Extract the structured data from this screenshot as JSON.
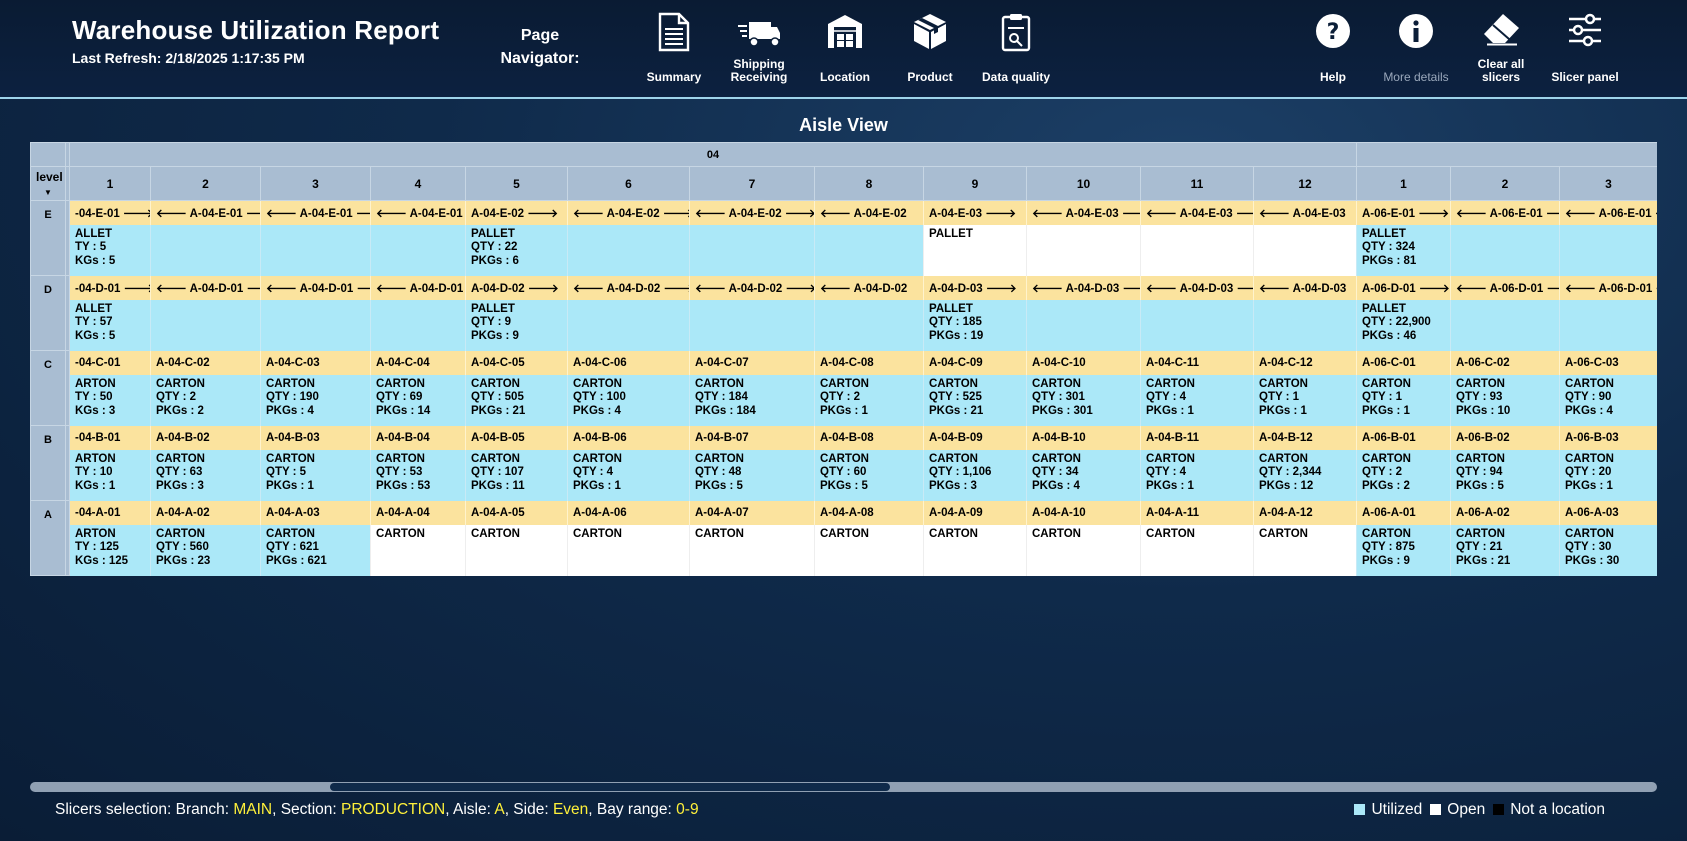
{
  "header": {
    "title": "Warehouse Utilization Report",
    "last_refresh": "Last Refresh: 2/18/2025 1:17:35 PM",
    "nav_label": "Page\nNavigator:"
  },
  "nav_buttons": [
    {
      "label": "Summary",
      "icon": "document-icon"
    },
    {
      "label": "Shipping\nReceiving",
      "icon": "truck-icon"
    },
    {
      "label": "Location",
      "icon": "warehouse-icon"
    },
    {
      "label": "Product",
      "icon": "box-icon"
    },
    {
      "label": "Data quality",
      "icon": "clipboard-icon"
    }
  ],
  "right_buttons": [
    {
      "label": "Help",
      "icon": "help-icon"
    },
    {
      "label": "More details",
      "icon": "info-icon"
    },
    {
      "label": "Clear all\nslicers",
      "icon": "eraser-icon"
    },
    {
      "label": "Slicer panel",
      "icon": "sliders-icon"
    }
  ],
  "view_title": "Aisle View",
  "grid": {
    "level_header": "level",
    "aisles": [
      {
        "label": "04",
        "span": 12
      },
      {
        "label": "",
        "span": 3
      }
    ],
    "bays": [
      "1",
      "2",
      "3",
      "4",
      "5",
      "6",
      "7",
      "8",
      "9",
      "10",
      "11",
      "12",
      "1",
      "2",
      "3"
    ],
    "levels": [
      {
        "level": "E",
        "locations": [
          "-04-E-01 🡒",
          "🡐 A-04-E-01 🡒",
          "🡐 A-04-E-01 🡒",
          "🡐 A-04-E-01",
          "A-04-E-02 🡒",
          "🡐 A-04-E-02 🡒",
          "🡐 A-04-E-02 🡒",
          "🡐 A-04-E-02",
          "A-04-E-03 🡒",
          "🡐 A-04-E-03 🡒",
          "🡐 A-04-E-03 🡒",
          "🡐 A-04-E-03",
          "A-06-E-01 🡒",
          "🡐 A-06-E-01 🡒",
          "🡐 A-06-E-01 🡒"
        ],
        "details": [
          "ALLET\nTY : 5\nKGs : 5",
          "",
          "",
          "",
          "PALLET\nQTY : 22\nPKGs : 6",
          "",
          "",
          "",
          "PALLET",
          "",
          "",
          "",
          "PALLET\nQTY : 324\nPKGs : 81",
          "",
          ""
        ],
        "states": [
          "u",
          "u",
          "u",
          "u",
          "u",
          "u",
          "u",
          "u",
          "o",
          "o",
          "o",
          "o",
          "u",
          "u",
          "u"
        ]
      },
      {
        "level": "D",
        "locations": [
          "-04-D-01 🡒",
          "🡐 A-04-D-01 🡒",
          "🡐 A-04-D-01 🡒",
          "🡐 A-04-D-01",
          "A-04-D-02 🡒",
          "🡐 A-04-D-02 🡒",
          "🡐 A-04-D-02 🡒",
          "🡐 A-04-D-02",
          "A-04-D-03 🡒",
          "🡐 A-04-D-03 🡒",
          "🡐 A-04-D-03 🡒",
          "🡐 A-04-D-03",
          "A-06-D-01 🡒",
          "🡐 A-06-D-01 🡒",
          "🡐 A-06-D-01 🡒"
        ],
        "details": [
          "ALLET\nTY : 57\nKGs : 5",
          "",
          "",
          "",
          "PALLET\nQTY : 9\nPKGs : 9",
          "",
          "",
          "",
          "PALLET\nQTY : 185\nPKGs : 19",
          "",
          "",
          "",
          "PALLET\nQTY : 22,900\nPKGs : 46",
          "",
          ""
        ],
        "states": [
          "u",
          "u",
          "u",
          "u",
          "u",
          "u",
          "u",
          "u",
          "u",
          "u",
          "u",
          "u",
          "u",
          "u",
          "u"
        ]
      },
      {
        "level": "C",
        "locations": [
          "-04-C-01",
          "A-04-C-02",
          "A-04-C-03",
          "A-04-C-04",
          "A-04-C-05",
          "A-04-C-06",
          "A-04-C-07",
          "A-04-C-08",
          "A-04-C-09",
          "A-04-C-10",
          "A-04-C-11",
          "A-04-C-12",
          "A-06-C-01",
          "A-06-C-02",
          "A-06-C-03"
        ],
        "details": [
          "ARTON\nTY : 50\nKGs : 3",
          "CARTON\nQTY : 2\nPKGs : 2",
          "CARTON\nQTY : 190\nPKGs : 4",
          "CARTON\nQTY : 69\nPKGs : 14",
          "CARTON\nQTY : 505\nPKGs : 21",
          "CARTON\nQTY : 100\nPKGs : 4",
          "CARTON\nQTY : 184\nPKGs : 184",
          "CARTON\nQTY : 2\nPKGs : 1",
          "CARTON\nQTY : 525\nPKGs : 21",
          "CARTON\nQTY : 301\nPKGs : 301",
          "CARTON\nQTY : 4\nPKGs : 1",
          "CARTON\nQTY : 1\nPKGs : 1",
          "CARTON\nQTY : 1\nPKGs : 1",
          "CARTON\nQTY : 93\nPKGs : 10",
          "CARTON\nQTY : 90\nPKGs : 4"
        ],
        "states": [
          "u",
          "u",
          "u",
          "u",
          "u",
          "u",
          "u",
          "u",
          "u",
          "u",
          "u",
          "u",
          "u",
          "u",
          "u"
        ]
      },
      {
        "level": "B",
        "locations": [
          "-04-B-01",
          "A-04-B-02",
          "A-04-B-03",
          "A-04-B-04",
          "A-04-B-05",
          "A-04-B-06",
          "A-04-B-07",
          "A-04-B-08",
          "A-04-B-09",
          "A-04-B-10",
          "A-04-B-11",
          "A-04-B-12",
          "A-06-B-01",
          "A-06-B-02",
          "A-06-B-03"
        ],
        "details": [
          "ARTON\nTY : 10\nKGs : 1",
          "CARTON\nQTY : 63\nPKGs : 3",
          "CARTON\nQTY : 5\nPKGs : 1",
          "CARTON\nQTY : 53\nPKGs : 53",
          "CARTON\nQTY : 107\nPKGs : 11",
          "CARTON\nQTY : 4\nPKGs : 1",
          "CARTON\nQTY : 48\nPKGs : 5",
          "CARTON\nQTY : 60\nPKGs : 5",
          "CARTON\nQTY : 1,106\nPKGs : 3",
          "CARTON\nQTY : 34\nPKGs : 4",
          "CARTON\nQTY : 4\nPKGs : 1",
          "CARTON\nQTY : 2,344\nPKGs : 12",
          "CARTON\nQTY : 2\nPKGs : 2",
          "CARTON\nQTY : 94\nPKGs : 5",
          "CARTON\nQTY : 20\nPKGs : 1"
        ],
        "states": [
          "u",
          "u",
          "u",
          "u",
          "u",
          "u",
          "u",
          "u",
          "u",
          "u",
          "u",
          "u",
          "u",
          "u",
          "u"
        ]
      },
      {
        "level": "A",
        "locations": [
          "-04-A-01",
          "A-04-A-02",
          "A-04-A-03",
          "A-04-A-04",
          "A-04-A-05",
          "A-04-A-06",
          "A-04-A-07",
          "A-04-A-08",
          "A-04-A-09",
          "A-04-A-10",
          "A-04-A-11",
          "A-04-A-12",
          "A-06-A-01",
          "A-06-A-02",
          "A-06-A-03"
        ],
        "details": [
          "ARTON\nTY : 125\nKGs : 125",
          "CARTON\nQTY : 560\nPKGs : 23",
          "CARTON\nQTY : 621\nPKGs : 621",
          "CARTON",
          "CARTON",
          "CARTON",
          "CARTON",
          "CARTON",
          "CARTON",
          "CARTON",
          "CARTON",
          "CARTON",
          "CARTON\nQTY : 875\nPKGs : 9",
          "CARTON\nQTY : 21\nPKGs : 21",
          "CARTON\nQTY : 30\nPKGs : 30"
        ],
        "states": [
          "u",
          "u",
          "u",
          "o",
          "o",
          "o",
          "o",
          "o",
          "o",
          "o",
          "o",
          "o",
          "u",
          "u",
          "u"
        ]
      }
    ]
  },
  "footer": {
    "prefix": "Slicers selection: Branch: ",
    "branch": "MAIN",
    "section_label": ", Section: ",
    "section": "PRODUCTION",
    "aisle_label": ", Aisle: ",
    "aisle": "A",
    "side_label": ", Side: ",
    "side": "Even",
    "bay_label": ", Bay range: ",
    "bay_range": "0-9"
  },
  "legend": [
    {
      "label": "Utilized",
      "color": "#abe8f8"
    },
    {
      "label": "Open",
      "color": "#ffffff"
    },
    {
      "label": "Not a location",
      "color": "#000000"
    }
  ],
  "colors": {
    "location_row": "#fbe39e",
    "utilized": "#abe8f8",
    "open": "#ffffff",
    "header_cell": "#a9bdd2",
    "highlight_text": "#fff13a"
  }
}
